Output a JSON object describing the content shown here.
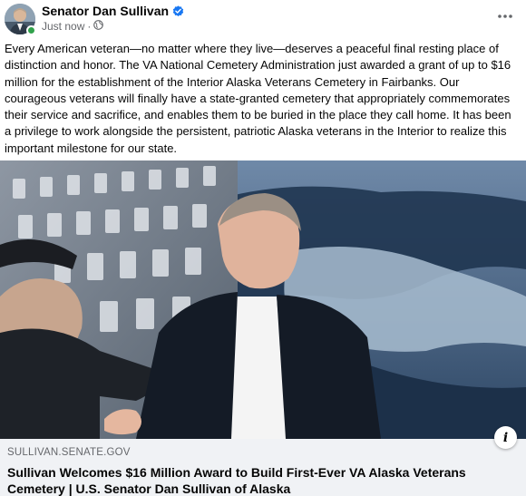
{
  "post": {
    "author": "Senator Dan Sullivan",
    "timestamp": "Just now",
    "separator": "·",
    "body": "Every American veteran—no matter where they live—deserves a peaceful final resting place of distinction and honor. The VA National Cemetery Administration just awarded a grant of up to $16 million for the establishment of the Interior Alaska Veterans Cemetery in Fairbanks. Our courageous veterans will finally have a state-granted cemetery that appropriately commemorates their service and sacrifice, and enables them to be buried in the place they call home. It has been a privilege to work alongside the persistent, patriotic Alaska veterans in the Interior to realize this important milestone for our state."
  },
  "link": {
    "domain": "SULLIVAN.SENATE.GOV",
    "title": "Sullivan Welcomes $16 Million Award to Build First-Ever VA Alaska Veterans Cemetery | U.S. Senator Dan Sullivan of Alaska",
    "info_glyph": "i"
  },
  "icons": {
    "verified": "verified-badge-icon",
    "audience": "globe-icon",
    "more": "more-options-icon",
    "info": "info-icon"
  },
  "colors": {
    "verified": "#1877f2",
    "online": "#31a24c",
    "secondary_text": "#65676b",
    "card_bg": "#f0f2f5"
  }
}
